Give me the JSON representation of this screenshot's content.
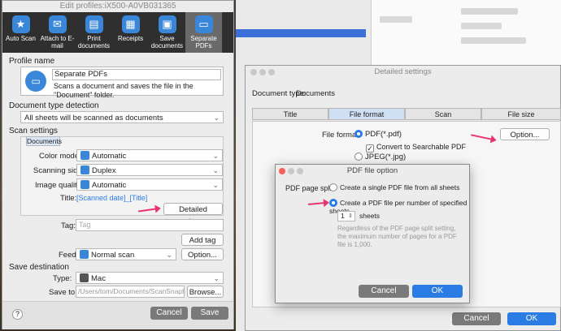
{
  "edit_window": {
    "title": "Edit profiles:iX500-A0VB031365",
    "toolbar": [
      {
        "label": "Auto Scan",
        "icon": "star-icon"
      },
      {
        "label": "Attach to E-mail",
        "icon": "mail-icon"
      },
      {
        "label": "Print documents",
        "icon": "printer-icon"
      },
      {
        "label": "Receipts",
        "icon": "receipt-icon"
      },
      {
        "label": "Save documents",
        "icon": "folder-save-icon"
      },
      {
        "label": "Separate PDFs",
        "icon": "folder-icon"
      }
    ],
    "profile_name_label": "Profile name",
    "profile_name": "Separate PDFs",
    "profile_desc": "Scans a document and saves the file in the \"Document\" folder.",
    "doc_type_label": "Document type detection",
    "doc_type_value": "All sheets will be scanned as documents",
    "scan_settings_label": "Scan settings",
    "documents_tab": "Documents",
    "color_mode_label": "Color mode:",
    "color_mode_value": "Automatic",
    "scanning_side_label": "Scanning side:",
    "scanning_side_value": "Duplex",
    "image_quality_label": "Image quality:",
    "image_quality_value": "Automatic",
    "title_label": "Title:",
    "title_value": "[Scanned date]_[Title]",
    "detailed_settings_btn": "Detailed settings...",
    "tag_label": "Tag:",
    "tag_placeholder": "Tag",
    "add_tag_btn": "Add tag",
    "feed_label": "Feed:",
    "feed_value": "Normal scan",
    "option_btn": "Option...",
    "save_dest_label": "Save destination",
    "type_label": "Type:",
    "type_value": "Mac",
    "save_to_label": "Save to:",
    "save_to_value": "/Users/tom/Documents/ScanSnapHom",
    "browse_btn": "Browse...",
    "help": "?",
    "cancel_btn": "Cancel",
    "save_btn": "Save"
  },
  "detail_window": {
    "title": "Detailed settings",
    "doc_type_label": "Document type:",
    "doc_type_value": "Documents",
    "tabs": [
      "Title",
      "File format",
      "Scan",
      "File size"
    ],
    "file_format_label": "File format:",
    "format_pdf": "PDF(*.pdf)",
    "option_btn": "Option...",
    "convert_searchable": "Convert to Searchable PDF",
    "format_jpeg": "JPEG(*.jpg)",
    "cancel_btn": "Cancel",
    "ok_btn": "OK"
  },
  "pdf_window": {
    "title": "PDF file option",
    "split_label": "PDF page split:",
    "option_single": "Create a single PDF file from all sheets",
    "option_per": "Create a PDF file per number of specified sheets",
    "sheets_value": "1",
    "sheets_label": "sheets",
    "note": "Regardless of the PDF page split setting, the maximum number of pages for a PDF file is 1,000.",
    "cancel_btn": "Cancel",
    "ok_btn": "OK"
  },
  "colors": {
    "accent": "#2a7be4",
    "arrow": "#e8336f",
    "toolbar_bg": "#2f2f2f"
  }
}
